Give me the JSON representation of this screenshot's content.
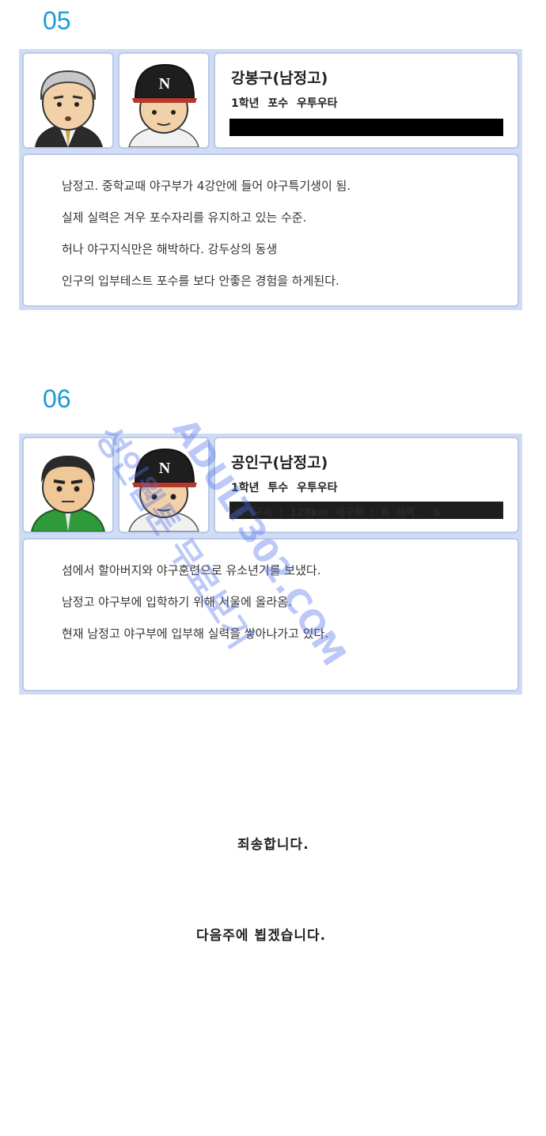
{
  "profiles": [
    {
      "number": "05",
      "name": "강봉구(남정고)",
      "meta": "1학년  포수  우투우타",
      "stats": "",
      "description": [
        "남정고. 중학교때 야구부가 4강안에 들어 야구특기생이 됨.",
        "실제 실력은 겨우 포수자리를 유지하고 있는 수준.",
        "허나 야구지식만은 해박하다. 강두상의 동생",
        "인구의 입부테스트 포수를 보다 안좋은 경험을 하게된다."
      ],
      "cap_letter": "N"
    },
    {
      "number": "06",
      "name": "공인구(남정고)",
      "meta": "1학년  투수  우투우타",
      "stats": "최고구속 : 128km  제구력 : B  체력 : S",
      "description": [
        "섬에서 할아버지와 야구훈련으로 유소년기를 보냈다.",
        "남정고 야구부에 입학하기 위해 서울에 올라옴.",
        "현재 남정고 야구부에 입부해 실력을 쌓아나가고 있다."
      ],
      "cap_letter": "N"
    }
  ],
  "messages": {
    "apology": "죄송합니다.",
    "next_week": "다음주에 뵙겠습니다."
  },
  "watermark": {
    "line1": "ADULT302.COM",
    "line2": "성인웹툰 무료보기"
  },
  "colors": {
    "number": "#1b9ad6",
    "card_border": "#b8c9ea",
    "card_bg": "#cfdcf3"
  }
}
